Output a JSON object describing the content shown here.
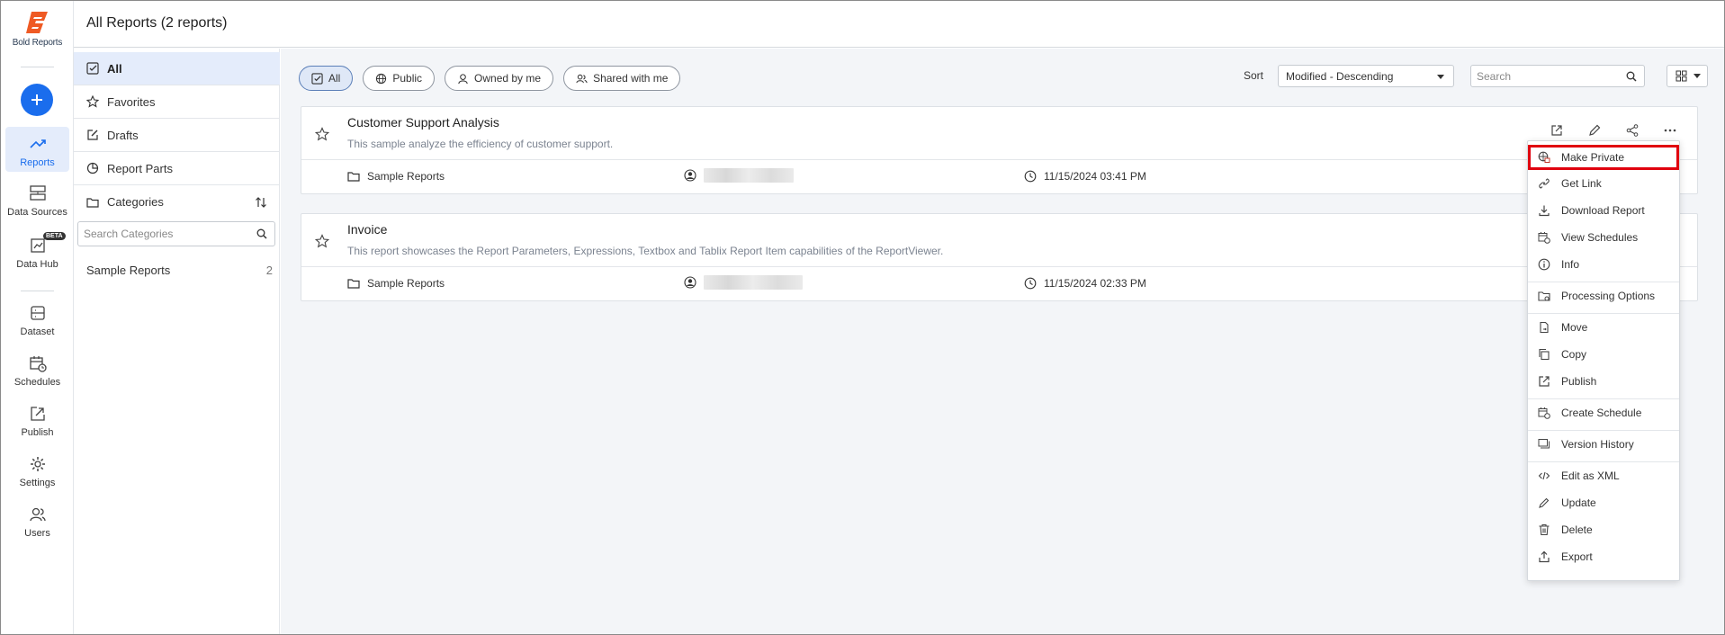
{
  "app": {
    "brand": "Bold Reports",
    "accent": "#1a6ded"
  },
  "rail": {
    "add_icon": "plus-icon",
    "items": [
      {
        "label": "Reports",
        "icon": "trend-icon",
        "active": true
      },
      {
        "label": "Data Sources",
        "icon": "data-sources-icon"
      },
      {
        "label": "Data Hub",
        "icon": "data-hub-icon",
        "badge": "BETA"
      },
      {
        "label": "Dataset",
        "icon": "dataset-icon"
      },
      {
        "label": "Schedules",
        "icon": "calendar-clock-icon"
      },
      {
        "label": "Publish",
        "icon": "publish-icon"
      },
      {
        "label": "Settings",
        "icon": "gear-icon"
      },
      {
        "label": "Users",
        "icon": "users-icon"
      }
    ]
  },
  "header": {
    "title": "All Reports (2 reports)"
  },
  "nav": {
    "items": [
      {
        "label": "All",
        "icon": "checkbox-icon",
        "active": true
      },
      {
        "label": "Favorites",
        "icon": "star-icon"
      },
      {
        "label": "Drafts",
        "icon": "edit-icon"
      },
      {
        "label": "Report Parts",
        "icon": "pie-icon"
      },
      {
        "label": "Categories",
        "icon": "folder-icon"
      }
    ],
    "category_search_placeholder": "Search Categories",
    "categories": [
      {
        "name": "Sample Reports",
        "count": "2"
      }
    ]
  },
  "filters": {
    "pills": [
      {
        "label": "All",
        "icon": "checkbox-icon",
        "active": true
      },
      {
        "label": "Public",
        "icon": "globe-icon"
      },
      {
        "label": "Owned by me",
        "icon": "user-icon"
      },
      {
        "label": "Shared with me",
        "icon": "shared-users-icon"
      }
    ],
    "sort_label": "Sort",
    "sort_value": "Modified - Descending",
    "search_placeholder": "Search"
  },
  "reports": [
    {
      "name": "Customer Support Analysis",
      "description": "This sample analyze the efficiency of customer support.",
      "category": "Sample Reports",
      "modified": "11/15/2024 03:41 PM"
    },
    {
      "name": "Invoice",
      "description": "This report showcases the Report Parameters, Expressions, Textbox and Tablix Report Item capabilities of the ReportViewer.",
      "category": "Sample Reports",
      "modified": "11/15/2024 02:33 PM"
    }
  ],
  "menu": {
    "highlight_color": "#e0000f",
    "items": [
      {
        "label": "Make Private",
        "icon": "lock-globe-icon"
      },
      {
        "label": "Get Link",
        "icon": "link-icon"
      },
      {
        "label": "Download Report",
        "icon": "download-icon"
      },
      {
        "label": "View Schedules",
        "icon": "calendar-clock-icon"
      },
      {
        "label": "Info",
        "icon": "info-icon"
      },
      {
        "label": "Processing Options",
        "icon": "processing-icon"
      },
      {
        "label": "Move",
        "icon": "move-icon"
      },
      {
        "label": "Copy",
        "icon": "copy-icon"
      },
      {
        "label": "Publish",
        "icon": "publish-icon"
      },
      {
        "label": "Create Schedule",
        "icon": "calendar-plus-icon"
      },
      {
        "label": "Version History",
        "icon": "version-icon"
      },
      {
        "label": "Edit as XML",
        "icon": "code-icon"
      },
      {
        "label": "Update",
        "icon": "pencil-icon"
      },
      {
        "label": "Delete",
        "icon": "trash-icon"
      },
      {
        "label": "Export",
        "icon": "export-icon"
      }
    ]
  }
}
